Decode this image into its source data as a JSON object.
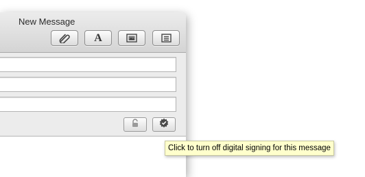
{
  "window": {
    "title": "New Message"
  },
  "toolbar": {
    "buttons": [
      {
        "icon": "paperclip-icon"
      },
      {
        "icon": "fonts-icon",
        "glyph": "A"
      },
      {
        "icon": "photo-browser-icon"
      },
      {
        "icon": "stationery-icon"
      }
    ]
  },
  "header_fields": [
    {
      "value": ""
    },
    {
      "value": ""
    },
    {
      "value": ""
    }
  ],
  "security": {
    "encrypt_icon": "lock-icon",
    "sign_icon": "signed-badge-icon"
  },
  "tooltip": {
    "text": "Click to turn off digital signing for this message"
  }
}
